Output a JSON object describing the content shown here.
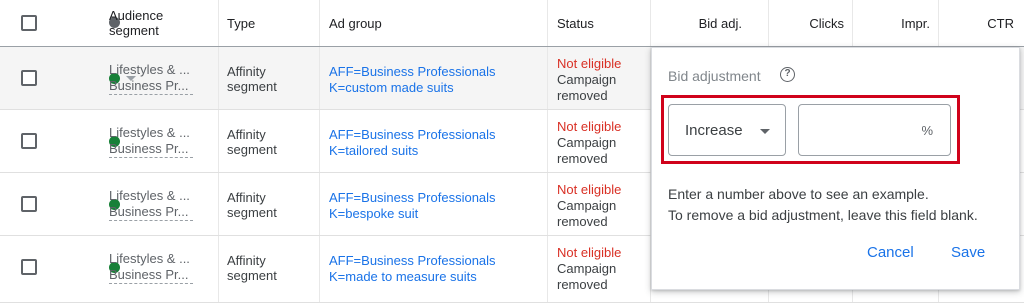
{
  "colors": {
    "link": "#1a73e8",
    "not_eligible": "#d93025",
    "status_dot": "#188038",
    "highlight": "#d0021b"
  },
  "header": {
    "audience_segment": [
      "Audience",
      "segment"
    ],
    "type": "Type",
    "ad_group": "Ad group",
    "status": "Status",
    "bid_adj": "Bid adj.",
    "clicks": "Clicks",
    "impr": "Impr.",
    "ctr": "CTR"
  },
  "rows": [
    {
      "segment": [
        "Lifestyles & ...",
        "Business Pr..."
      ],
      "type": [
        "Affinity",
        "segment"
      ],
      "ad_group": [
        "AFF=Business Professionals",
        "K=custom made suits"
      ],
      "status": [
        "Not eligible",
        "Campaign",
        "removed"
      ]
    },
    {
      "segment": [
        "Lifestyles & ...",
        "Business Pr..."
      ],
      "type": [
        "Affinity",
        "segment"
      ],
      "ad_group": [
        "AFF=Business Professionals",
        "K=tailored suits"
      ],
      "status": [
        "Not eligible",
        "Campaign",
        "removed"
      ]
    },
    {
      "segment": [
        "Lifestyles & ...",
        "Business Pr..."
      ],
      "type": [
        "Affinity",
        "segment"
      ],
      "ad_group": [
        "AFF=Business Professionals",
        "K=bespoke suit"
      ],
      "status": [
        "Not eligible",
        "Campaign",
        "removed"
      ]
    },
    {
      "segment": [
        "Lifestyles & ...",
        "Business Pr..."
      ],
      "type": [
        "Affinity",
        "segment"
      ],
      "ad_group": [
        "AFF=Business Professionals",
        "K=made to measure suits"
      ],
      "status": [
        "Not eligible",
        "Campaign",
        "removed"
      ]
    }
  ],
  "popup": {
    "title": "Bid adjustment",
    "help_icon": "help-circle-icon",
    "help_glyph": "?",
    "select_value": "Increase",
    "input_value": "",
    "input_suffix": "%",
    "help_line1": "Enter a number above to see an example.",
    "help_line2": "To remove a bid adjustment, leave this field blank.",
    "cancel_label": "Cancel",
    "save_label": "Save"
  }
}
